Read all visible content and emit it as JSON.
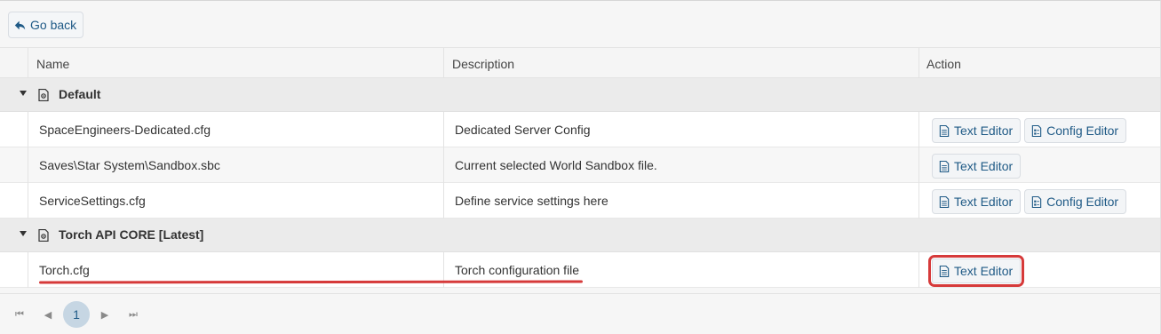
{
  "toolbar": {
    "go_back_label": "Go back"
  },
  "table": {
    "columns": [
      "Name",
      "Description",
      "Action"
    ],
    "groups": [
      {
        "title": "Default",
        "rows": [
          {
            "name": "SpaceEngineers-Dedicated.cfg",
            "description": "Dedicated Server Config",
            "actions": [
              "Text Editor",
              "Config Editor"
            ]
          },
          {
            "name": "Saves\\Star System\\Sandbox.sbc",
            "description": "Current selected World Sandbox file.",
            "actions": [
              "Text Editor"
            ]
          },
          {
            "name": "ServiceSettings.cfg",
            "description": "Define service settings here",
            "actions": [
              "Text Editor",
              "Config Editor"
            ]
          }
        ]
      },
      {
        "title": "Torch API CORE [Latest]",
        "rows": [
          {
            "name": "Torch.cfg",
            "description": "Torch configuration file",
            "actions": [
              "Text Editor"
            ]
          }
        ]
      }
    ]
  },
  "pager": {
    "current_page": "1",
    "first": "⏮",
    "prev": "◀",
    "next": "▶",
    "last": "⏭"
  },
  "colors": {
    "accent": "#1f5a86",
    "highlight": "#d63a3a",
    "current_page_bg": "#c6d6e3"
  },
  "icons": {
    "go_back": "arrow-back-icon",
    "group": "config-file-icon",
    "text_editor": "document-icon",
    "config_editor": "config-editor-icon"
  }
}
